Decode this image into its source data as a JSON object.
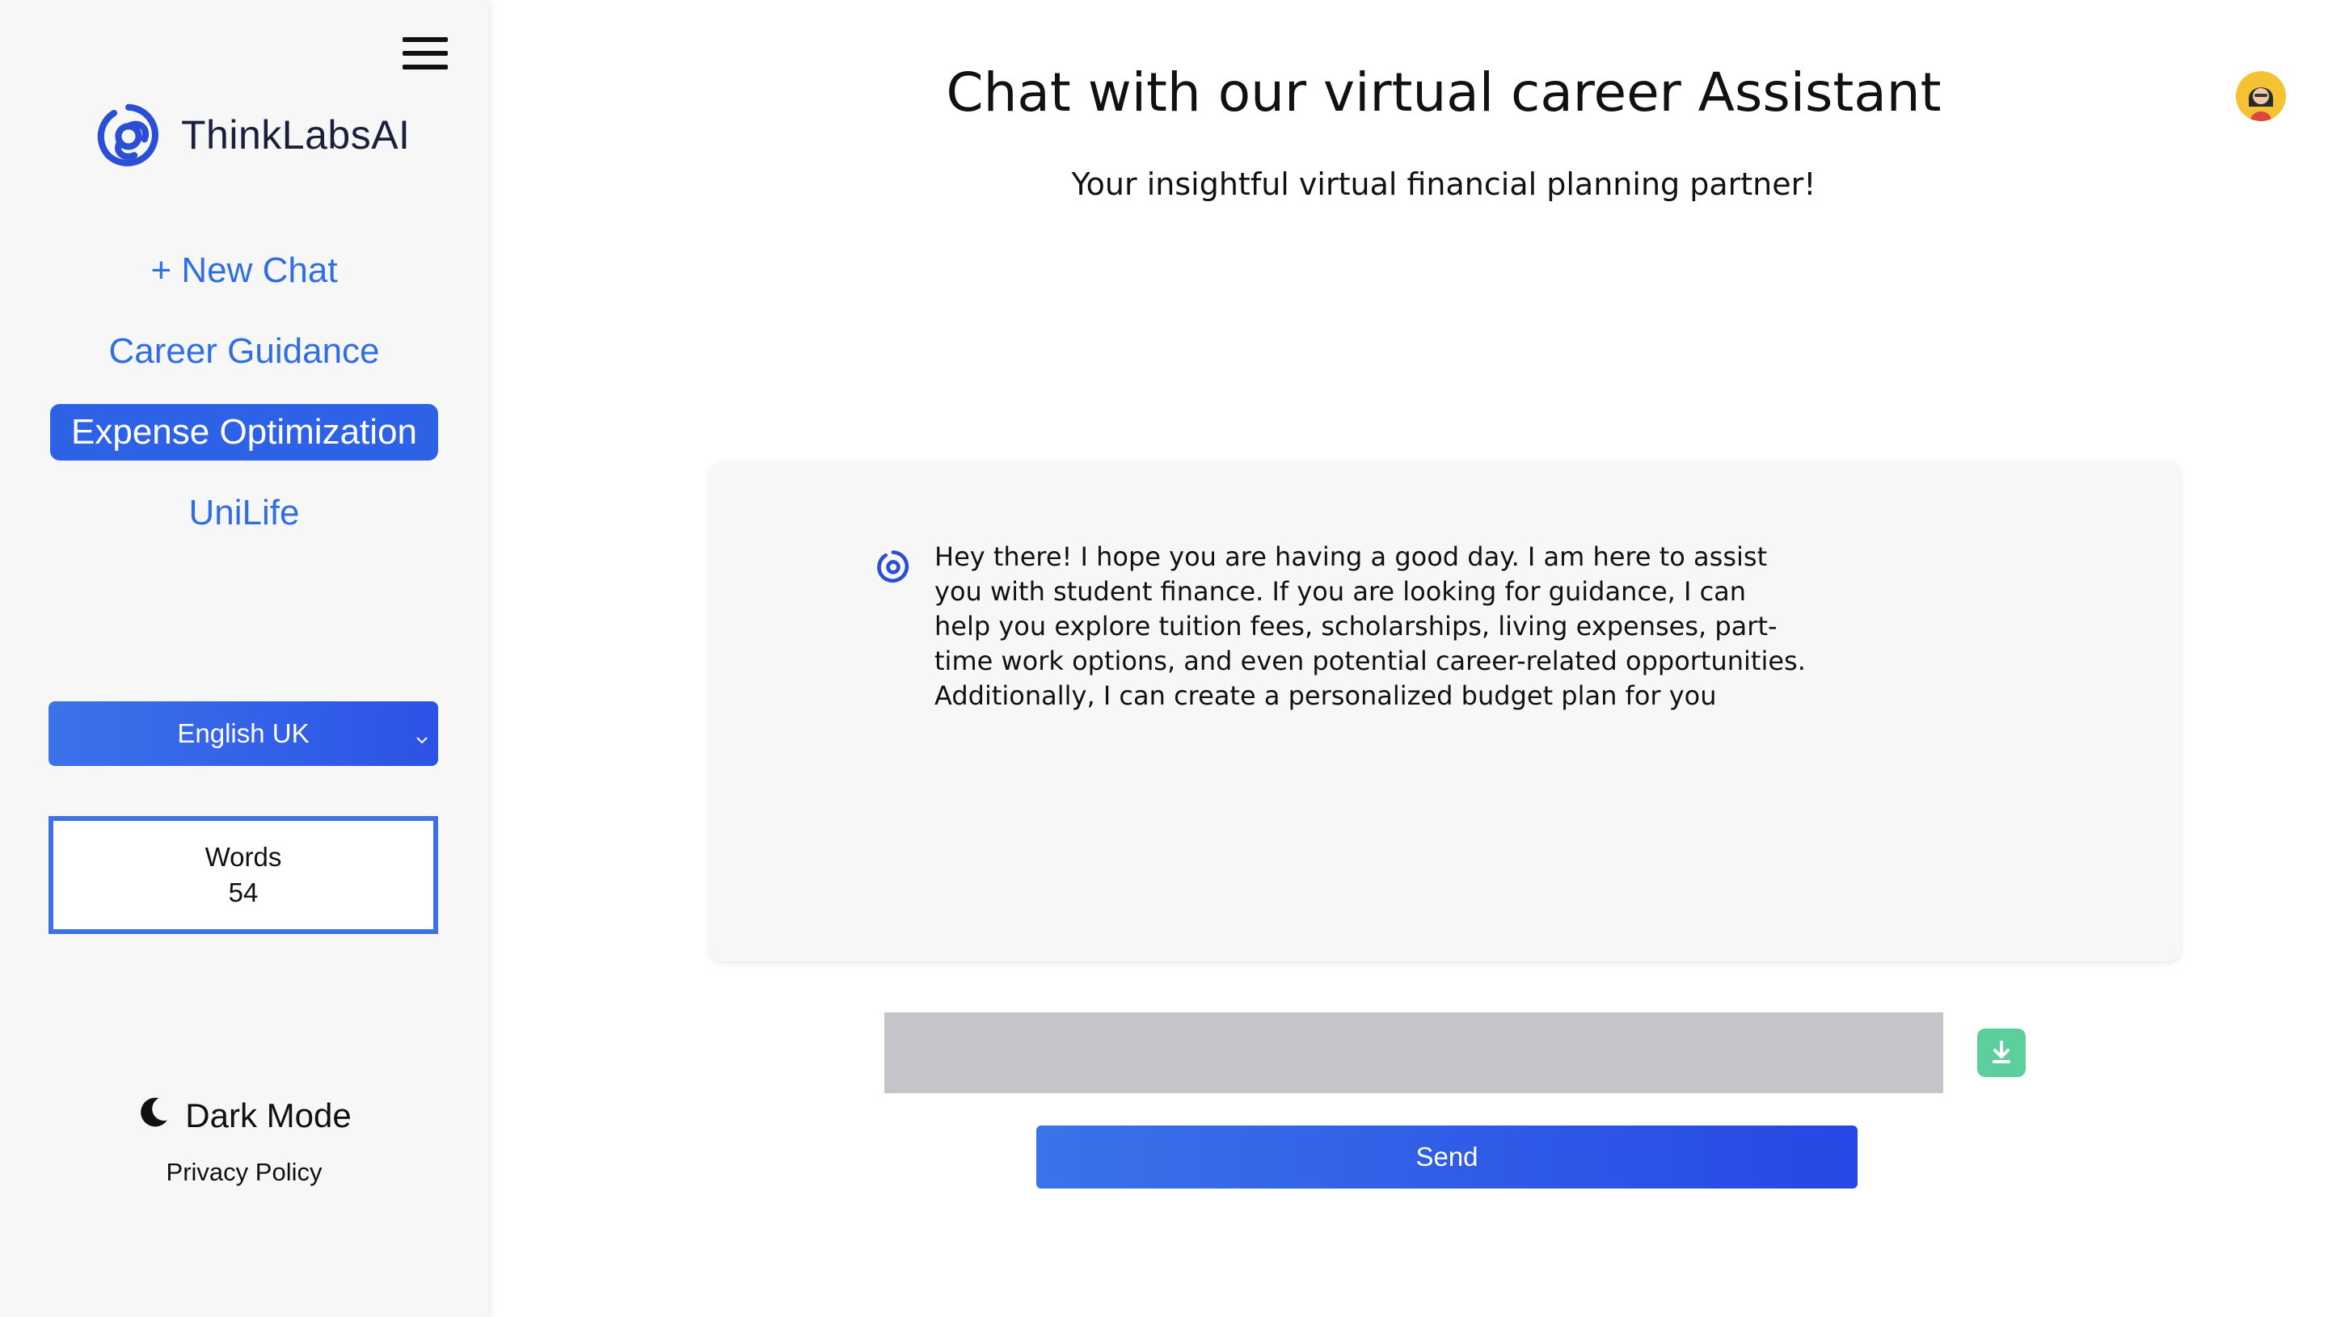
{
  "brand": {
    "name": "ThinkLabsAI"
  },
  "sidebar": {
    "nav": [
      {
        "label": "+ New Chat",
        "active": false
      },
      {
        "label": "Career Guidance",
        "active": false
      },
      {
        "label": "Expense Optimization",
        "active": true
      },
      {
        "label": "UniLife",
        "active": false
      }
    ],
    "language": {
      "selected": "English UK"
    },
    "words": {
      "label": "Words",
      "count": "54"
    },
    "dark_mode_label": "Dark Mode",
    "privacy_label": "Privacy Policy"
  },
  "main": {
    "title": "Chat with our virtual career Assistant",
    "subtitle": "Your insightful virtual financial planning partner!",
    "messages": [
      {
        "role": "assistant",
        "text": "Hey there! I hope you are having a good day. I am here to assist you with student finance. If you are looking for guidance, I can help you explore tuition fees, scholarships, living expenses, part-time work options, and even potential career-related opportunities. Additionally, I can create a personalized budget plan for you"
      }
    ],
    "input": {
      "value": "",
      "placeholder": ""
    },
    "send_label": "Send"
  },
  "colors": {
    "accent": "#2e62e6",
    "link": "#2f6ee3",
    "download": "#5ccf9d",
    "input_bg": "#c4c5cb",
    "avatar_bg": "#f5c234"
  },
  "icons": [
    "menu-icon",
    "brand-logo-icon",
    "chevron-down-icon",
    "moon-icon",
    "download-icon",
    "user-avatar"
  ]
}
